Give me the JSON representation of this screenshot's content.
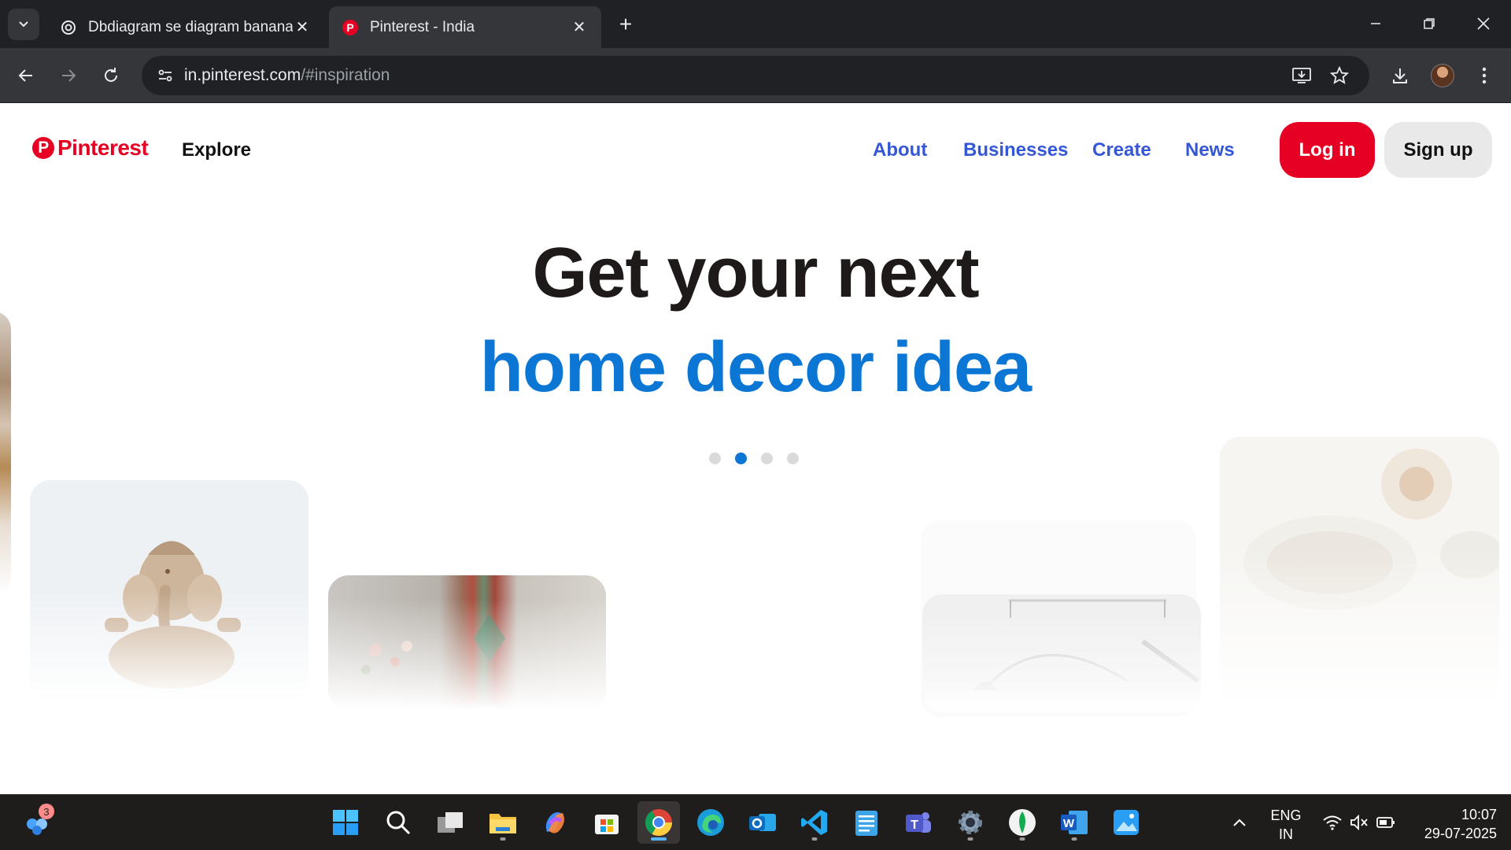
{
  "browser": {
    "tabs": [
      {
        "title": "Dbdiagram se diagram banana",
        "favicon": "chatgpt-icon",
        "active": false
      },
      {
        "title": "Pinterest - India",
        "favicon": "pinterest-icon",
        "active": true
      }
    ],
    "url_host": "in.pinterest.com",
    "url_path": "/#inspiration"
  },
  "site": {
    "logo_text": "Pinterest",
    "explore_label": "Explore",
    "nav": [
      "About",
      "Businesses",
      "Create",
      "News"
    ],
    "login_label": "Log in",
    "signup_label": "Sign up",
    "headline": "Get your next",
    "headline_accent": "home decor idea",
    "carousel": {
      "count": 4,
      "active_index": 1
    },
    "colors": {
      "brand": "#e60023",
      "accent": "#0b76d4",
      "nav_link": "#3457d5"
    }
  },
  "taskbar": {
    "notification_badge": "3",
    "apps": [
      "copilot-people-icon",
      "windows-start-icon",
      "search-icon",
      "task-view-icon",
      "file-explorer-icon",
      "copilot-icon",
      "microsoft-store-icon",
      "chrome-icon",
      "edge-icon",
      "outlook-icon",
      "vscode-icon",
      "notepad-icon",
      "teams-icon",
      "settings-icon",
      "mongodb-compass-icon",
      "word-icon",
      "photos-icon"
    ],
    "language_line1": "ENG",
    "language_line2": "IN",
    "time": "10:07",
    "date": "29-07-2025"
  }
}
